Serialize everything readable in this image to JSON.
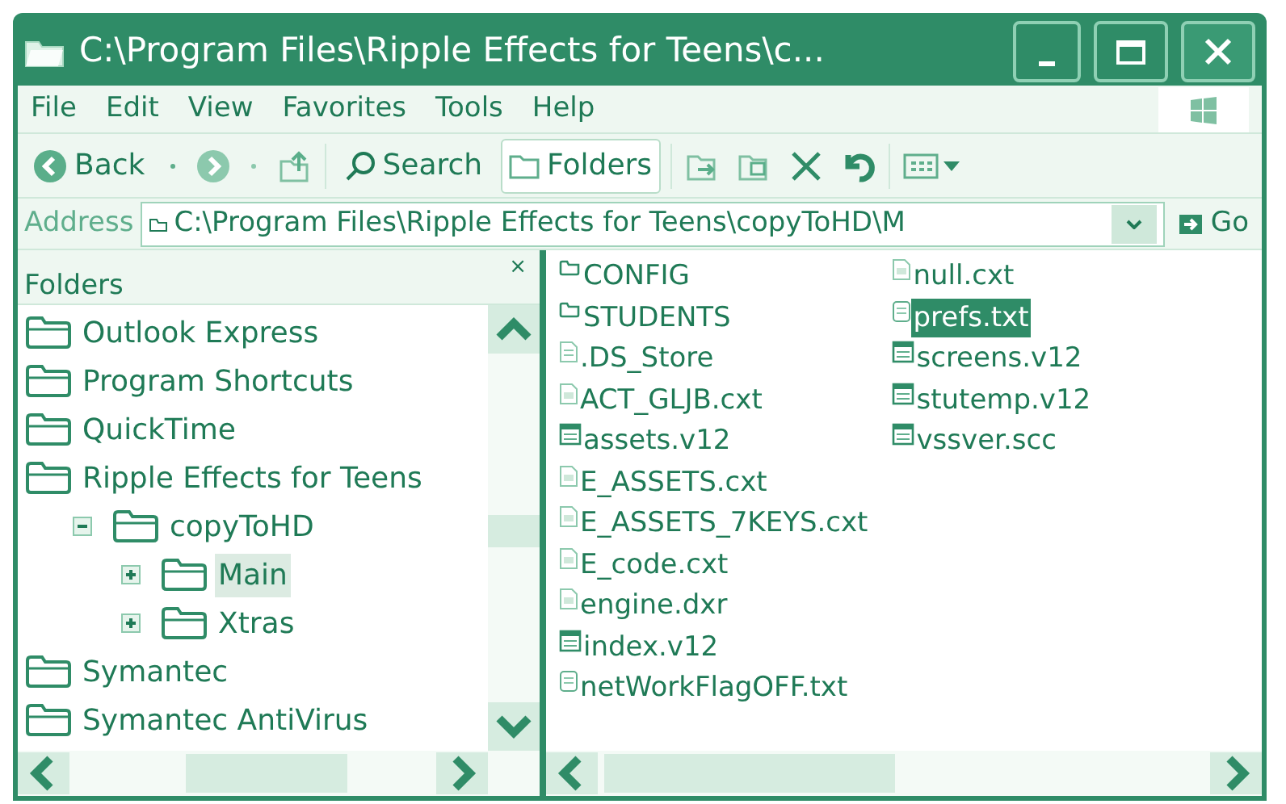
{
  "window": {
    "title": "C:\\Program Files\\Ripple Effects for Teens\\c..."
  },
  "menu": [
    "File",
    "Edit",
    "View",
    "Favorites",
    "Tools",
    "Help"
  ],
  "toolbar": [
    {
      "kind": "back",
      "label": "Back",
      "pressed": false
    },
    {
      "kind": "search",
      "label": "Search",
      "pressed": false
    },
    {
      "kind": "folders",
      "label": "Folders",
      "pressed": true
    }
  ],
  "address": {
    "label": "Address",
    "value": "C:\\Program Files\\Ripple Effects for Teens\\copyToHD\\M",
    "go": "Go"
  },
  "folders_pane": {
    "title": "Folders",
    "close": "×",
    "tree": [
      {
        "label": "Outlook Express",
        "selected": false
      },
      {
        "label": "Program Shortcuts",
        "selected": false
      },
      {
        "label": "QuickTime",
        "selected": false
      },
      {
        "label": "Ripple Effects for Teens",
        "selected": false,
        "children": [
          {
            "label": "copyToHD",
            "selected": false,
            "expanded": true,
            "children": [
              {
                "label": "Main",
                "selected": true,
                "expanded": false
              },
              {
                "label": "Xtras",
                "selected": false,
                "expanded": false
              }
            ]
          }
        ]
      },
      {
        "label": "Symantec",
        "selected": false
      },
      {
        "label": "Symantec AntiVirus",
        "selected": false
      }
    ]
  },
  "files": [
    {
      "name": "CONFIG",
      "kind": "folder",
      "selected": false
    },
    {
      "name": "STUDENTS",
      "kind": "folder",
      "selected": false
    },
    {
      "name": ".DS_Store",
      "kind": "file",
      "selected": false
    },
    {
      "name": "ACT_GLJB.cxt",
      "kind": "cast",
      "selected": false
    },
    {
      "name": "assets.v12",
      "kind": "movie",
      "selected": false
    },
    {
      "name": "E_ASSETS.cxt",
      "kind": "cast",
      "selected": false
    },
    {
      "name": "E_ASSETS_7KEYS.cxt",
      "kind": "cast",
      "selected": false
    },
    {
      "name": "E_code.cxt",
      "kind": "cast",
      "selected": false
    },
    {
      "name": "engine.dxr",
      "kind": "cast",
      "selected": false
    },
    {
      "name": "index.v12",
      "kind": "movie",
      "selected": false
    },
    {
      "name": "netWorkFlagOFF.txt",
      "kind": "text",
      "selected": false
    },
    {
      "name": "null.cxt",
      "kind": "cast",
      "selected": false
    },
    {
      "name": "prefs.txt",
      "kind": "text",
      "selected": true
    },
    {
      "name": "screens.v12",
      "kind": "movie",
      "selected": false
    },
    {
      "name": "stutemp.v12",
      "kind": "movie",
      "selected": false
    },
    {
      "name": "vssver.scc",
      "kind": "movie",
      "selected": false
    }
  ]
}
